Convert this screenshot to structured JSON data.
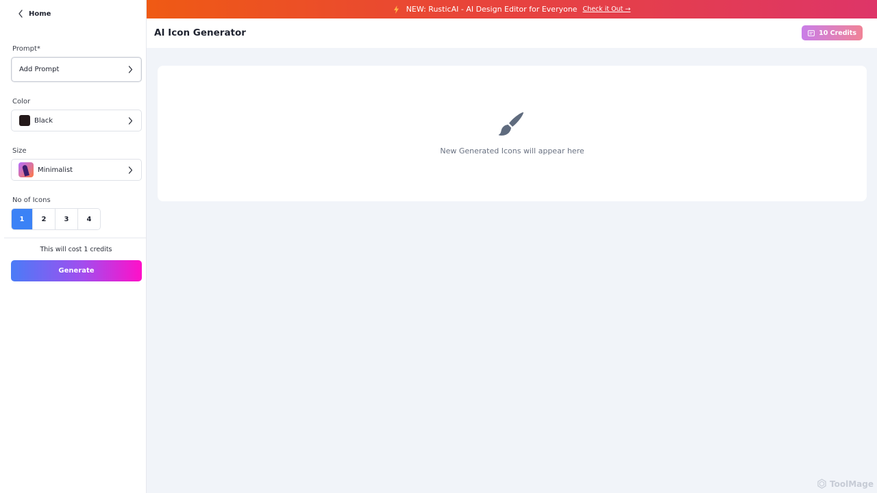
{
  "sidebar": {
    "home_label": "Home",
    "prompt": {
      "label": "Prompt*",
      "value": "Add Prompt"
    },
    "color": {
      "label": "Color",
      "value": "Black",
      "swatch": "#24191a"
    },
    "size": {
      "label": "Size",
      "value": "Minimalist"
    },
    "icon_count": {
      "label": "No of Icons",
      "options": [
        "1",
        "2",
        "3",
        "4"
      ],
      "selected": "1"
    },
    "cost_text": "This will cost 1 credits",
    "generate_label": "Generate"
  },
  "banner": {
    "message": "NEW: RusticAI - AI Design Editor for Everyone",
    "cta": "Check it Out →"
  },
  "header": {
    "title": "AI Icon Generator",
    "credits_label": "10 Credits"
  },
  "main": {
    "empty_text": "New Generated Icons will appear here"
  },
  "watermark": {
    "text": "ToolMage"
  },
  "colors": {
    "accent_blue": "#3b82f6",
    "banner_start": "#ef5a14",
    "banner_end": "#de3568",
    "generate_start": "#4a7cf7",
    "generate_end": "#ff10c8"
  }
}
